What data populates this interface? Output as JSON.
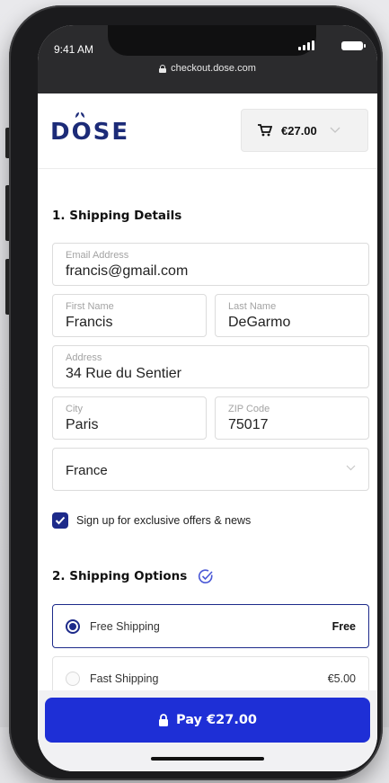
{
  "status_bar": {
    "time": "9:41 AM",
    "url": "checkout.dose.com"
  },
  "header": {
    "logo": "DOSE",
    "cart_total": "€27.00"
  },
  "shipping_details": {
    "title": "1. Shipping Details",
    "email": {
      "label": "Email Address",
      "value": "francis@gmail.com"
    },
    "first_name": {
      "label": "First Name",
      "value": "Francis"
    },
    "last_name": {
      "label": "Last Name",
      "value": "DeGarmo"
    },
    "address": {
      "label": "Address",
      "value": "34 Rue du Sentier"
    },
    "city": {
      "label": "City",
      "value": "Paris"
    },
    "zip": {
      "label": "ZIP Code",
      "value": "75017"
    },
    "country": {
      "value": "France"
    },
    "newsletter": {
      "label": "Sign up for exclusive offers & news",
      "checked": true
    }
  },
  "shipping_options": {
    "title": "2. Shipping Options",
    "options": [
      {
        "name": "Free Shipping",
        "price": "Free",
        "selected": true
      },
      {
        "name": "Fast Shipping",
        "price": "€5.00",
        "selected": false
      }
    ]
  },
  "pay_button": {
    "label": "Pay €27.00"
  },
  "colors": {
    "brand_navy": "#1c2b78",
    "pay_blue": "#1e2fd6",
    "selected_border": "#1d2a8a"
  }
}
